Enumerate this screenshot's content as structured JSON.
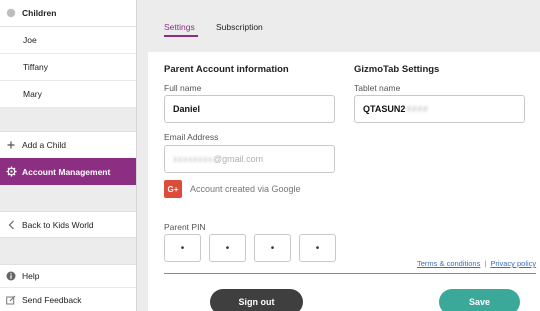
{
  "sidebar": {
    "children_heading": "Children",
    "children": [
      "Joe",
      "Tiffany",
      "Mary"
    ],
    "add_child": "Add a Child",
    "account_management": "Account Management",
    "back": "Back to Kids World",
    "help": "Help",
    "feedback": "Send Feedback"
  },
  "tabs": {
    "settings": "Settings",
    "subscription": "Subscription"
  },
  "parent": {
    "title": "Parent Account information",
    "full_name_label": "Full name",
    "full_name_value": "Daniel",
    "email_label": "Email Address",
    "email_masked": "xxxxxxxx",
    "email_domain": "@gmail.com",
    "google_text": "Account created via Google",
    "google_badge": "G+",
    "pin_label": "Parent PIN",
    "pin_dots": [
      "•",
      "•",
      "•",
      "•"
    ]
  },
  "gizmo": {
    "title": "GizmoTab Settings",
    "tablet_label": "Tablet name",
    "tablet_value": "QTASUN2",
    "tablet_masked": "####"
  },
  "links": {
    "terms": "Terms & conditions",
    "separator": "|",
    "privacy": "Privacy policy"
  },
  "buttons": {
    "sign_out": "Sign out",
    "save": "Save"
  },
  "colors": {
    "accent": "#8c2f83",
    "save": "#3aa99a",
    "signout": "#3f3f3f",
    "google": "#dd4b39",
    "link": "#3a6fb5"
  }
}
